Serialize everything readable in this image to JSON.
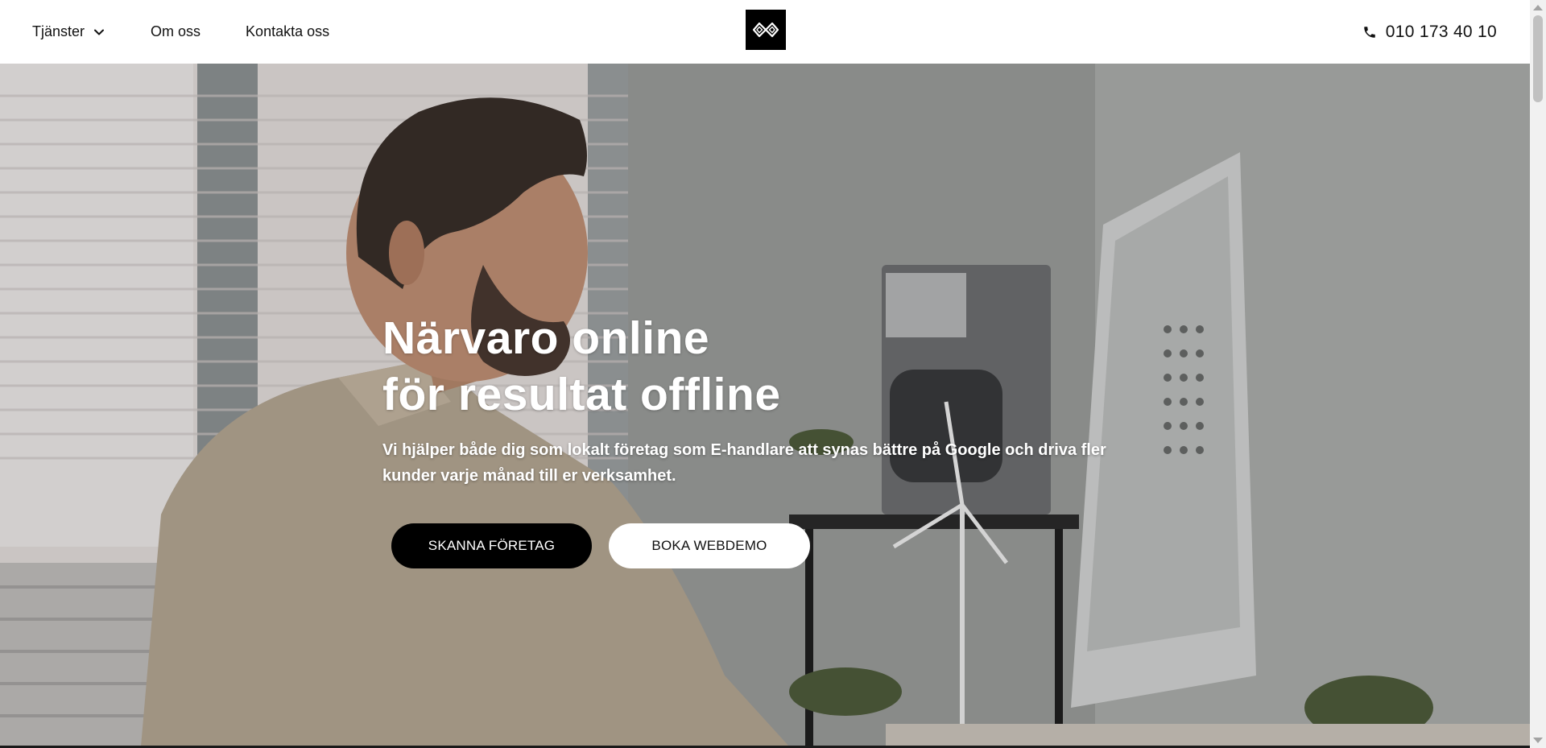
{
  "header": {
    "nav": [
      {
        "label": "Tjänster",
        "has_dropdown": true
      },
      {
        "label": "Om oss"
      },
      {
        "label": "Kontakta oss"
      }
    ],
    "logo_icon": "brand-logo-icon",
    "phone": {
      "icon": "phone-icon",
      "number": "010 173 40 10"
    }
  },
  "hero": {
    "title_line1": "Närvaro online",
    "title_line2": "för resultat offline",
    "subtitle": "Vi hjälper både dig som lokalt företag som E-handlare att synas bättre på Google och driva fler kunder varje månad till er verksamhet.",
    "primary_cta": "SKANNA FÖRETAG",
    "secondary_cta": "BOKA WEBDEMO"
  },
  "colors": {
    "primary_button": "#000000",
    "secondary_button": "#ffffff",
    "text_on_hero": "#ffffff"
  }
}
